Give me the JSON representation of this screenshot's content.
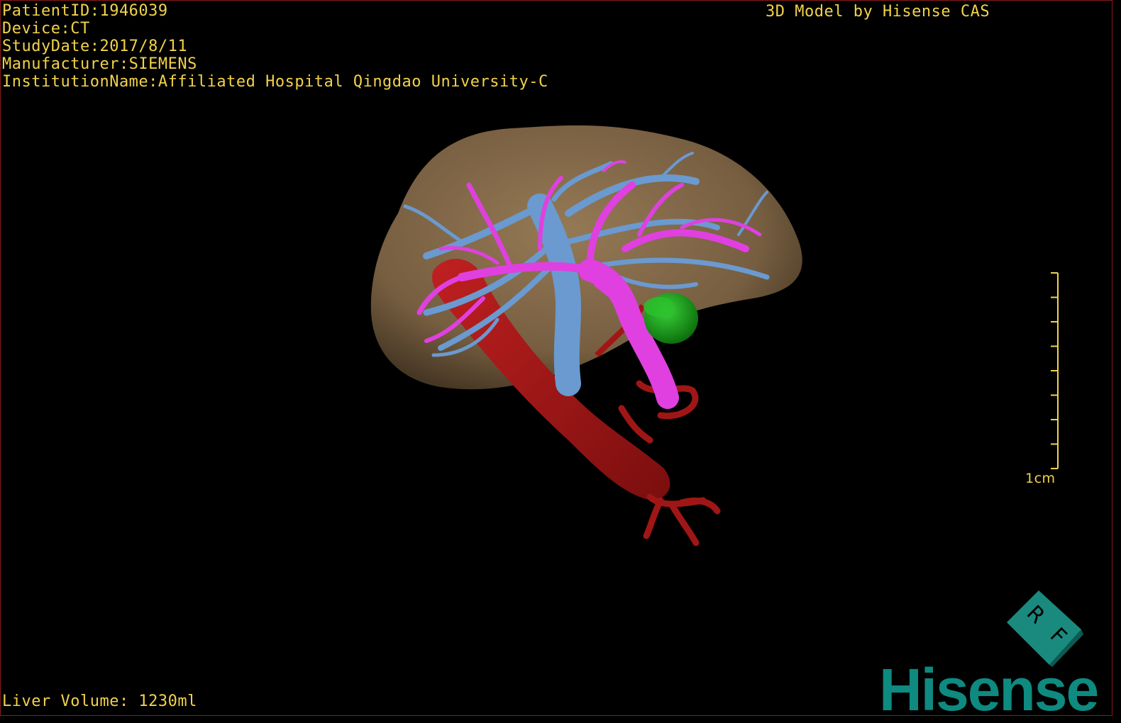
{
  "header": {
    "patient_id": "PatientID:1946039",
    "device": "Device:CT",
    "study_date": "StudyDate:2017/8/11",
    "manufacturer": "Manufacturer:SIEMENS",
    "institution": "InstitutionName:Affiliated Hospital Qingdao University-C"
  },
  "credit": "3D Model by Hisense CAS",
  "footer": {
    "liver_volume": "Liver Volume: 1230ml"
  },
  "scale": {
    "label": "1cm",
    "ticks": 9
  },
  "orientation_cube": {
    "letters": [
      "R",
      "F"
    ]
  },
  "brand": {
    "name": "Hisense"
  },
  "colors": {
    "overlay_text": "#f2d24a",
    "liver": "#8a6e4a",
    "hepatic_vein": "#6a9ad0",
    "portal_vein": "#e040e0",
    "artery": "#a81818",
    "lesion": "#1e9a1e",
    "brand": "#0e8a80"
  },
  "model_parts": [
    "liver",
    "hepatic-vein",
    "portal-vein",
    "artery",
    "lesion"
  ]
}
